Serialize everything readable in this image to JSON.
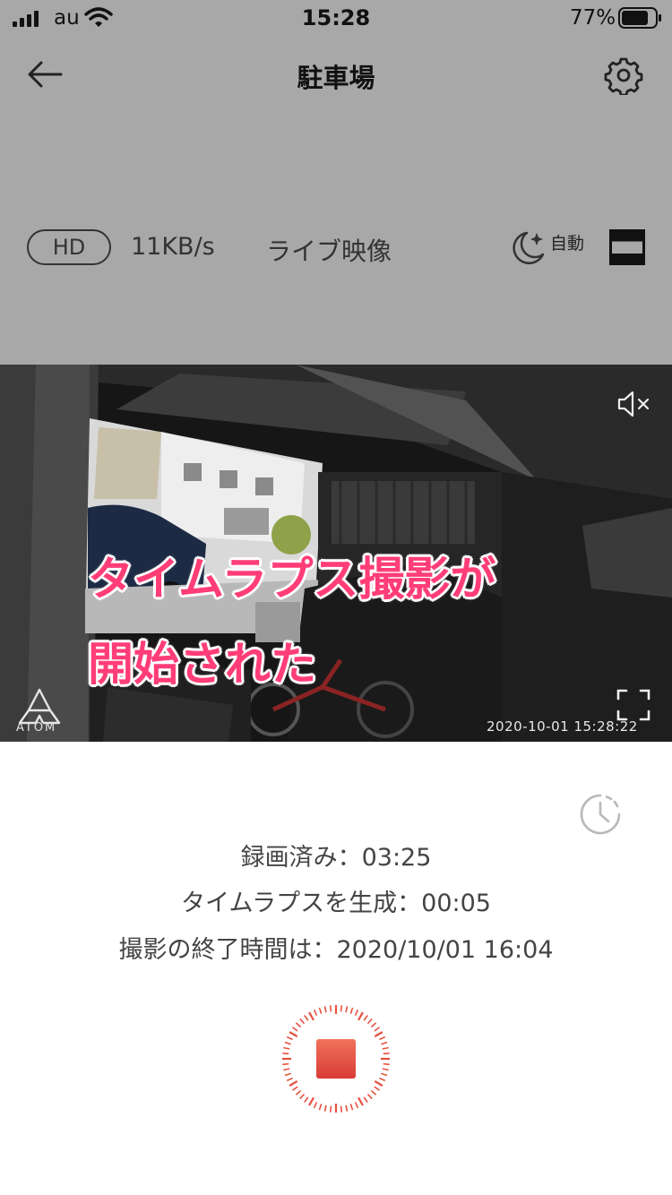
{
  "status_bar": {
    "carrier": "au",
    "time": "15:28",
    "battery_percent": "77%",
    "signal_icon": "cellular-signal-icon",
    "wifi_icon": "wifi-icon",
    "battery_icon": "battery-icon"
  },
  "nav": {
    "title": "駐車場",
    "back_icon": "back-arrow-icon",
    "settings_icon": "gear-icon"
  },
  "controls": {
    "quality_badge": "HD",
    "speed": "11KB/s",
    "mode_label": "ライブ映像",
    "night_vision_label": "自動",
    "night_vision_icon": "moon-icon",
    "layout_icon": "layout-toggle-icon"
  },
  "camera": {
    "overlay_line_1": "タイムラプス撮影が",
    "overlay_line_2": "開始された",
    "logo_text": "ATOM",
    "timestamp": "2020-10-01  15:28:22",
    "mute_icon": "speaker-muted-icon",
    "fullscreen_icon": "fullscreen-icon"
  },
  "timelapse": {
    "timer_icon": "clock-timer-icon",
    "recorded": "録画済み：03:25",
    "generated": "タイムラプスを生成：00:05",
    "end_time": "撮影の終了時間は：2020/10/01 16:04",
    "stop_icon": "stop-record-icon"
  },
  "colors": {
    "top_background": "#a8a8a8",
    "overlay_text": "#ff3d77",
    "record_accent": "#e8503f"
  }
}
